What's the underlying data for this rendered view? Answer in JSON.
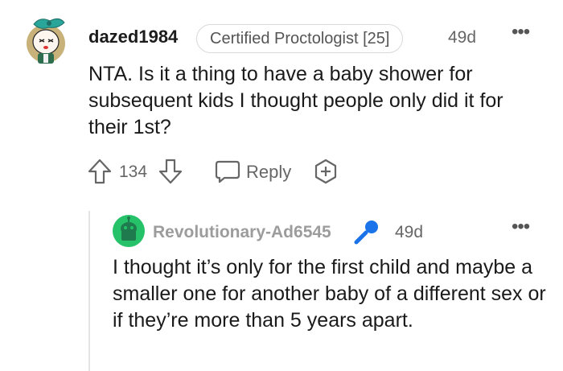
{
  "comment": {
    "username": "dazed1984",
    "flair": "Certified Proctologist [25]",
    "age": "49d",
    "more": "•••",
    "body": "NTA. Is it a thing to have a baby shower for subsequent kids I thought people only did it for their 1st?",
    "upvote_icon": "upvote-arrow-icon",
    "vote_count": "134",
    "downvote_icon": "downvote-arrow-icon",
    "reply_icon": "chat-bubble-icon",
    "reply_label": "Reply",
    "award_icon": "add-award-icon"
  },
  "reply": {
    "username": "Revolutionary-Ad6545",
    "badge_icon": "microphone-icon",
    "age": "49d",
    "more": "•••",
    "body": "I thought it’s only for the first child and maybe a smaller one for another baby of a different sex or if they’re more than 5 years apart."
  },
  "colors": {
    "reply_avatar_bg": "#25c26a",
    "mic_blue": "#1a73e8",
    "avatar_teal": "#2aa59a"
  }
}
